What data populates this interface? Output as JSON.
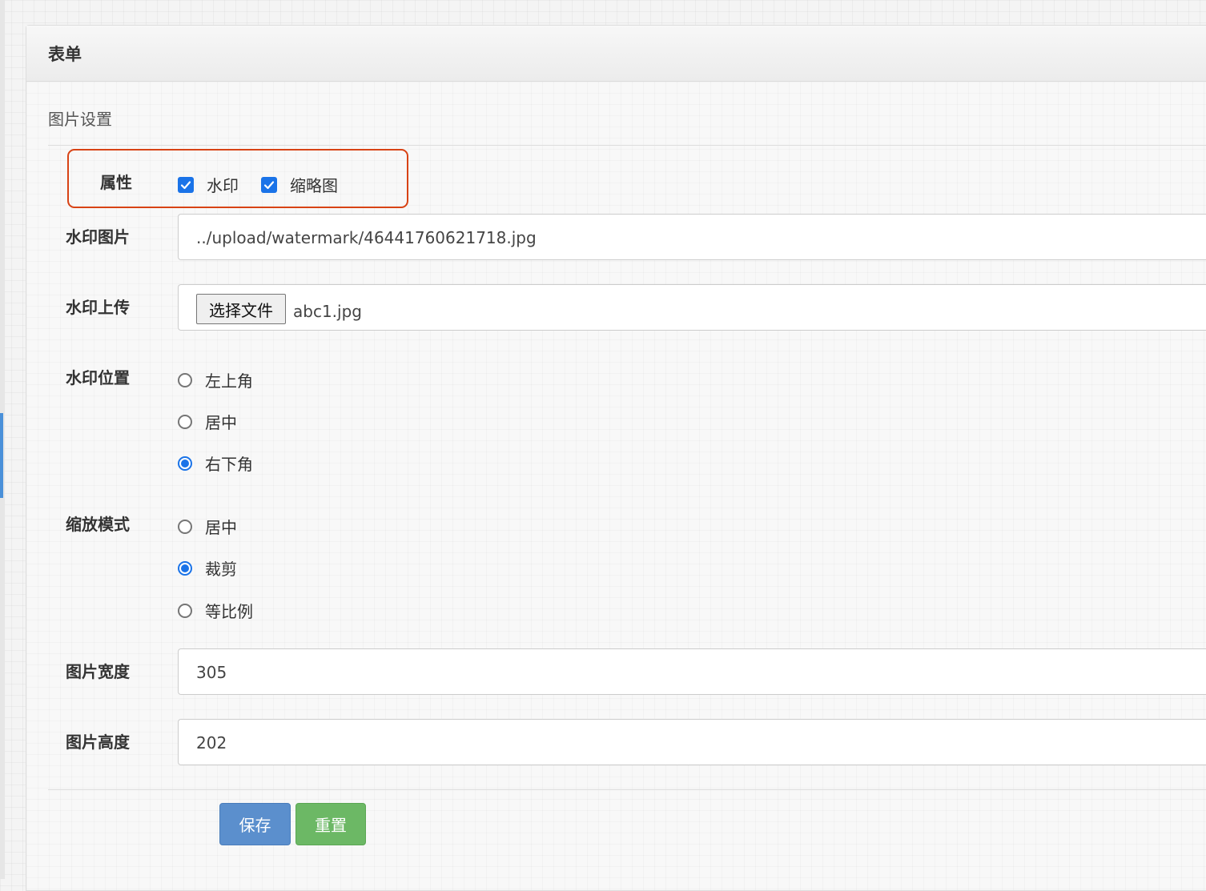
{
  "panel": {
    "title": "表单"
  },
  "section": {
    "title": "图片设置"
  },
  "fields": {
    "attributes": {
      "label": "属性",
      "options": [
        {
          "label": "水印",
          "checked": true
        },
        {
          "label": "缩略图",
          "checked": true
        }
      ]
    },
    "watermark_image": {
      "label": "水印图片",
      "value": "../upload/watermark/46441760621718.jpg"
    },
    "watermark_upload": {
      "label": "水印上传",
      "button_label": "选择文件",
      "file_name": "abc1.jpg"
    },
    "watermark_position": {
      "label": "水印位置",
      "options": [
        {
          "label": "左上角",
          "selected": false
        },
        {
          "label": "居中",
          "selected": false
        },
        {
          "label": "右下角",
          "selected": true
        }
      ]
    },
    "scale_mode": {
      "label": "缩放模式",
      "options": [
        {
          "label": "居中",
          "selected": false
        },
        {
          "label": "裁剪",
          "selected": true
        },
        {
          "label": "等比例",
          "selected": false
        }
      ]
    },
    "image_width": {
      "label": "图片宽度",
      "value": "305"
    },
    "image_height": {
      "label": "图片高度",
      "value": "202"
    }
  },
  "actions": {
    "save_label": "保存",
    "reset_label": "重置"
  },
  "colors": {
    "accent": "#1a73e8",
    "save": "#5b8fcd",
    "reset": "#6cb865",
    "highlight": "#d84315"
  }
}
